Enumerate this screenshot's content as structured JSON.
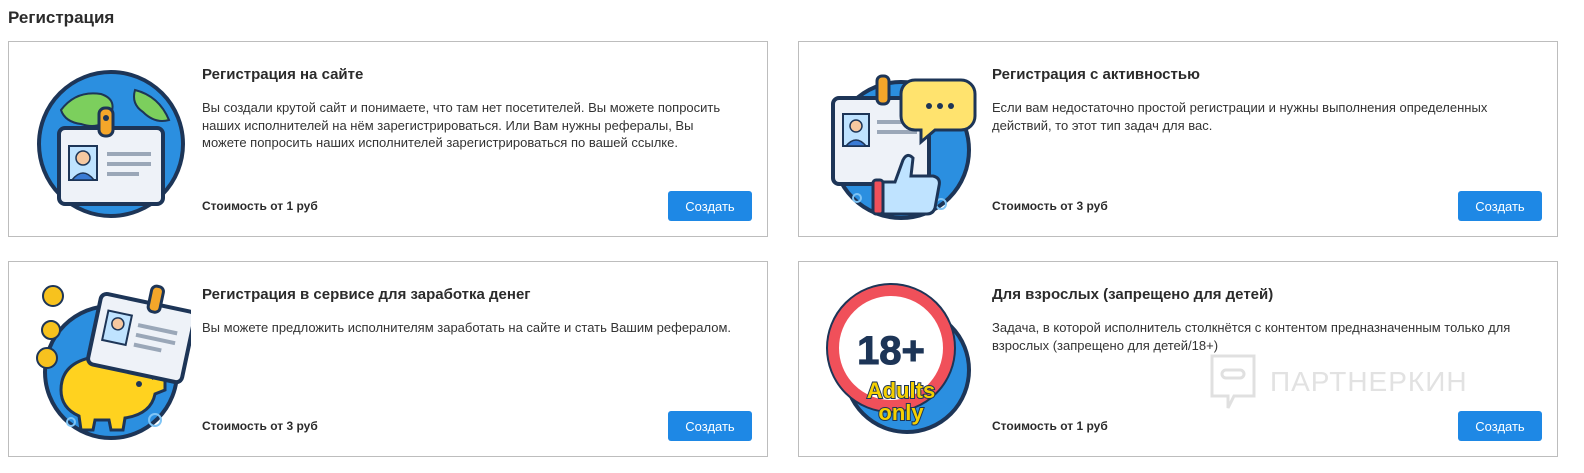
{
  "page": {
    "title": "Регистрация"
  },
  "cards": [
    {
      "title": "Регистрация на сайте",
      "description": "Вы создали крутой сайт и понимаете, что там нет посетителей. Вы можете попросить наших исполнителей на нём зарегистрироваться. Или Вам нужны рефералы, Вы можете попросить наших исполнителей зарегистрироваться по вашей ссылке.",
      "price": "Стоимость от 1 руб",
      "button": "Создать"
    },
    {
      "title": "Регистрация с активностью",
      "description": "Если вам недостаточно простой регистрации и нужны выполнения определенных действий, то этот тип задач для вас.",
      "price": "Стоимость от 3 руб",
      "button": "Создать"
    },
    {
      "title": "Регистрация в сервисе для заработка денег",
      "description": "Вы можете предложить исполнителям заработать на сайте и стать Вашим рефералом.",
      "price": "Стоимость от 3 руб",
      "button": "Создать"
    },
    {
      "title": "Для взрослых (запрещено для детей)",
      "description": "Задача, в которой исполнитель столкнётся с контентом предназначенным только для взрослых (запрещено для детей/18+)",
      "price": "Стоимость от 1 руб",
      "button": "Создать",
      "badge_number": "18+",
      "badge_line1": "Adults",
      "badge_line2": "only"
    }
  ],
  "watermark": {
    "text": "ПАРТНЕРКИН"
  },
  "colors": {
    "accent": "#1e88e5",
    "circle_blue": "#2b8fe0",
    "outline": "#1d3557",
    "prohibit_red": "#f0505a",
    "badge_yellow": "#f5d000"
  },
  "icons": [
    "id-card-globe-icon",
    "id-card-thumbs-up-icon",
    "id-card-piggy-bank-icon",
    "adults-only-18-icon",
    "watermark-logo-icon"
  ]
}
